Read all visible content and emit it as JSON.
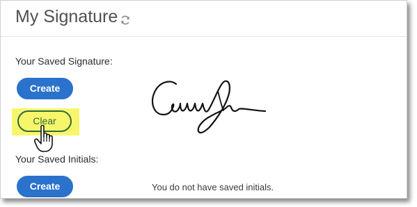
{
  "header": {
    "title": "My Signature",
    "refresh_icon": "refresh-icon"
  },
  "signature_section": {
    "label": "Your Saved Signature:",
    "create_label": "Create",
    "clear_label": "Clear",
    "highlight_color": "#f7f66b"
  },
  "initials_section": {
    "label": "Your Saved Initials:",
    "create_label": "Create",
    "empty_message": "You do not have saved initials."
  },
  "colors": {
    "primary_button": "#2a72cc",
    "clear_border": "#2f6a3e"
  },
  "cursor_icon": "hand-pointer-icon"
}
